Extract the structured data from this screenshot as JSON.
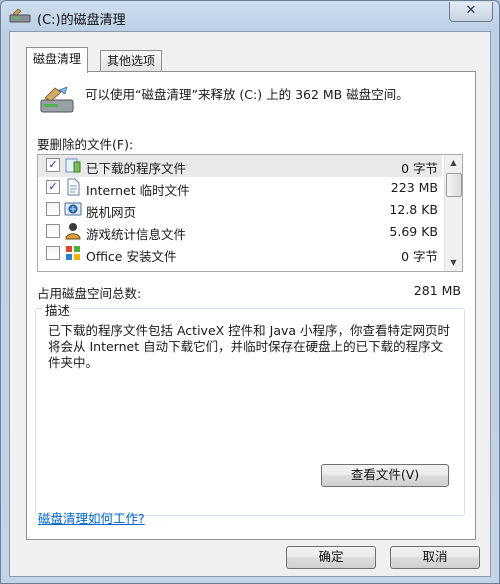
{
  "window": {
    "title": "(C:)的磁盘清理",
    "close_symbol": "✕"
  },
  "tabs": [
    {
      "label": "磁盘清理",
      "active": true
    },
    {
      "label": "其他选项",
      "active": false
    }
  ],
  "intro": {
    "text": "可以使用“磁盘清理”来释放 (C:) 上的 362 MB 磁盘空间。"
  },
  "files": {
    "label": "要删除的文件(F):",
    "items": [
      {
        "name": "已下载的程序文件",
        "size": "0 字节",
        "checked": "✓",
        "icon": "folder-icon"
      },
      {
        "name": "Internet 临时文件",
        "size": "223 MB",
        "checked": "✓",
        "icon": "document-icon"
      },
      {
        "name": "脱机网页",
        "size": "12.8 KB",
        "checked": "",
        "icon": "offline-pages-icon"
      },
      {
        "name": "游戏统计信息文件",
        "size": "5.69 KB",
        "checked": "",
        "icon": "game-stats-icon"
      },
      {
        "name": "Office 安装文件",
        "size": "0 字节",
        "checked": "",
        "icon": "office-icon"
      }
    ]
  },
  "total": {
    "label": "占用磁盘空间总数:",
    "value": "281 MB"
  },
  "description": {
    "legend": "描述",
    "text": "已下载的程序文件包括 ActiveX 控件和 Java 小程序，你查看特定网页时将会从 Internet 自动下载它们，并临时保存在硬盘上的已下载的程序文件夹中。"
  },
  "buttons": {
    "view_files": "查看文件(V)",
    "ok": "确定",
    "cancel": "取消"
  },
  "help_link": "磁盘清理如何工作?",
  "scrollbar": {
    "up": "▲",
    "down": "▼"
  }
}
